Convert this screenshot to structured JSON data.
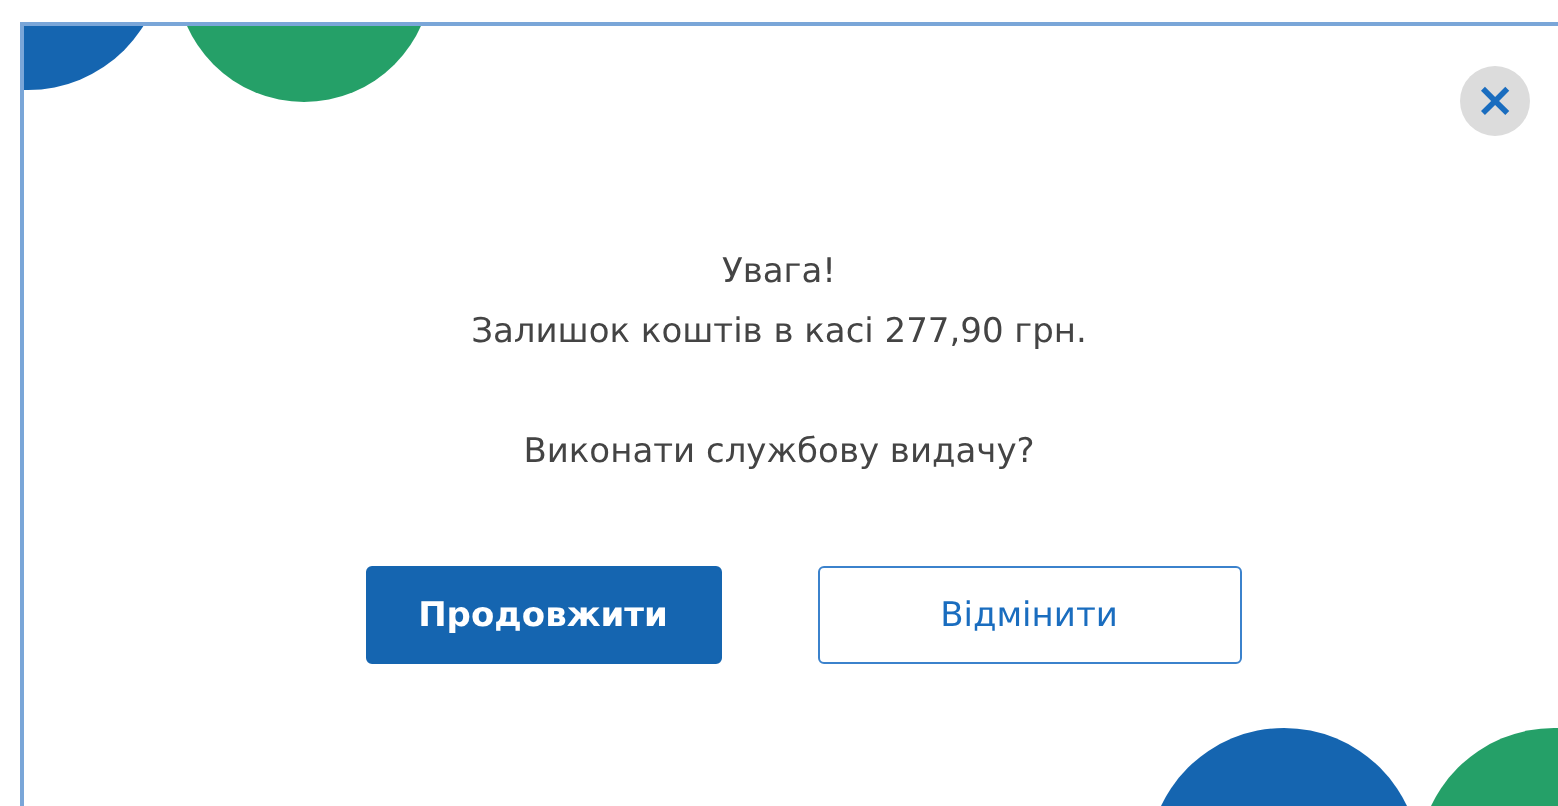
{
  "dialog": {
    "close_button": "×",
    "message": [
      "Увага!",
      "Залишок коштів в касі 277,90 грн."
    ],
    "question": "Виконати службову видачу?",
    "buttons": [
      {
        "label": "Продовжити",
        "kind": "primary"
      },
      {
        "label": "Відмінити",
        "kind": "secondary"
      }
    ]
  }
}
